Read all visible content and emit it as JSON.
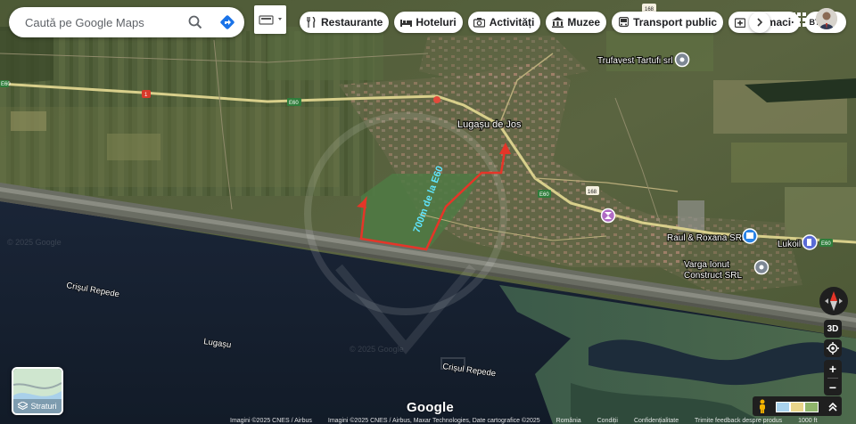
{
  "search": {
    "placeholder": "Caută pe Google Maps"
  },
  "chips": [
    {
      "label": "Restaurante",
      "icon": "fork-knife-icon"
    },
    {
      "label": "Hoteluri",
      "icon": "bed-icon"
    },
    {
      "label": "Activități",
      "icon": "camera-icon"
    },
    {
      "label": "Muzee",
      "icon": "museum-icon"
    },
    {
      "label": "Transport public",
      "icon": "bus-icon"
    },
    {
      "label": "Farmacii",
      "icon": "pharmacy-icon"
    },
    {
      "label": "BTM",
      "icon": "atm-icon"
    }
  ],
  "map": {
    "town": "Lugașu de Jos",
    "places": [
      "Trufavest Tartufi srl",
      "Raul & Roxana SRL",
      "Lukoil",
      "Varga Ionut",
      "Construct SRL"
    ],
    "water_labels": [
      "Crișul Repede",
      "Lugașu",
      "Crișul Repede"
    ],
    "road_shields": [
      "E60",
      "1",
      "E60",
      "168",
      "E60",
      "168",
      "E60"
    ],
    "watermarks": [
      "© 2025 Google",
      "© 2025 Google"
    ],
    "overlay_text": "700m de la E60",
    "colors": {
      "overlay_red": "#e53528",
      "overlay_cyan": "#5fe6ff"
    }
  },
  "controls": {
    "layers_label": "Straturi",
    "view3d": "3D",
    "zoom_in": "+",
    "zoom_out": "−"
  },
  "footer": {
    "logo": "Google",
    "attribution": [
      "Imagini ©2025 CNES / Airbus",
      "Imagini ©2025 CNES / Airbus, Maxar Technologies, Date cartografice ©2025",
      "România",
      "Condiții",
      "Confidențialitate",
      "Trimite feedback despre produs",
      "1000 ft"
    ]
  }
}
